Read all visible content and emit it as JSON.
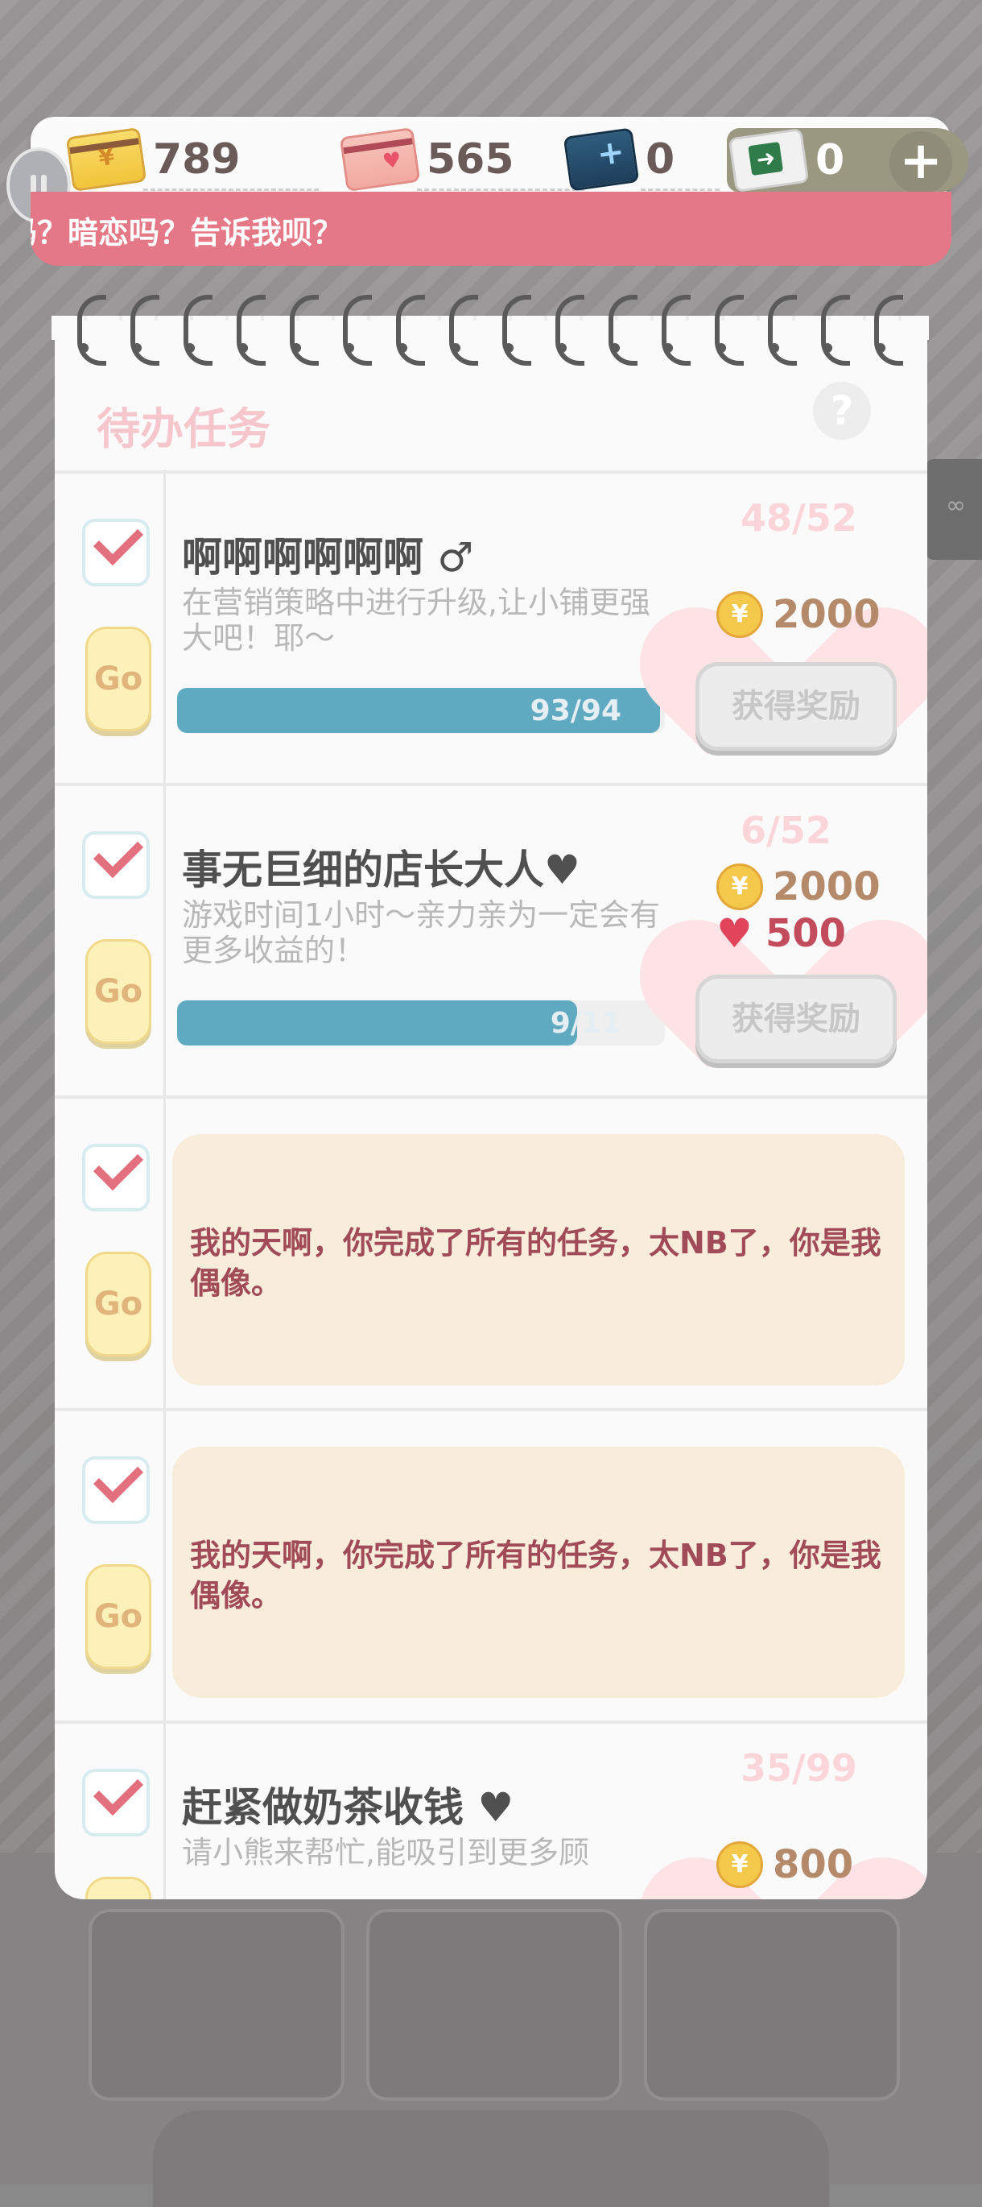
{
  "currency": {
    "gold": "789",
    "love": "565",
    "ticket": "0",
    "cash": "0",
    "add_label": "+"
  },
  "marquee": {
    "text": "吗？暗恋吗？告诉我呗？"
  },
  "panel": {
    "title": "待办任务",
    "help_label": "?"
  },
  "tasks": [
    {
      "title": "啊啊啊啊啊啊 ♂",
      "desc": "在营销策略中进行升级,让小铺更强大吧！耶～",
      "progress_text": "93/94",
      "progress": 0.99,
      "count": "48/52",
      "reward_gold": "2000",
      "reward_love": "",
      "go": "Go",
      "claim": "获得奖励"
    },
    {
      "title": "事无巨细的店长大人♥",
      "desc": "游戏时间1小时～亲力亲为一定会有更多收益的！",
      "progress_text": "9/11",
      "progress": 0.82,
      "count": "6/52",
      "reward_gold": "2000",
      "reward_love": "500",
      "go": "Go",
      "claim": "获得奖励"
    },
    {
      "done_text": "我的天啊，你完成了所有的任务，太NB了，你是我偶像。",
      "go": "Go"
    },
    {
      "done_text": "我的天啊，你完成了所有的任务，太NB了，你是我偶像。",
      "go": "Go"
    },
    {
      "title": "赶紧做奶茶收钱 ♥",
      "desc": "请小熊来帮忙,能吸引到更多顾",
      "count": "35/99",
      "reward_gold": "800",
      "go": "Go"
    }
  ],
  "colors": {
    "accent": "#e57886",
    "progress": "#5fa9c1",
    "done_text": "#a14a58"
  }
}
